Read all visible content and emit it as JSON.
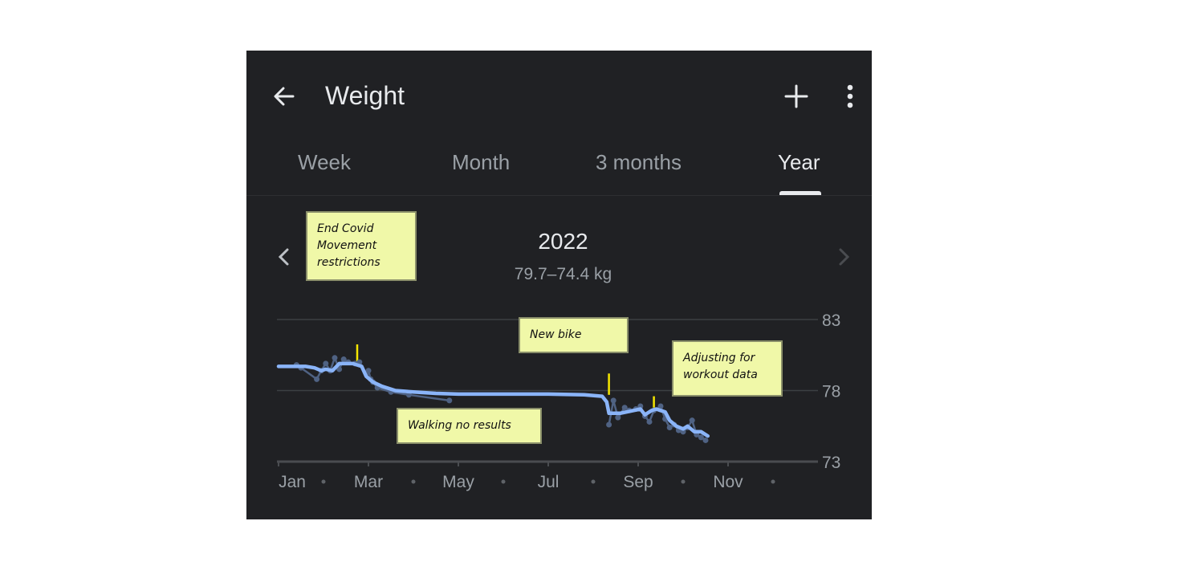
{
  "header": {
    "title": "Weight",
    "back_icon": "arrow-left-icon",
    "add_icon": "plus-icon",
    "more_icon": "more-vert-icon"
  },
  "tabs": [
    {
      "label": "Week",
      "active": false
    },
    {
      "label": "Month",
      "active": false
    },
    {
      "label": "3 months",
      "active": false
    },
    {
      "label": "Year",
      "active": true
    }
  ],
  "period": {
    "year": "2022",
    "range": "79.7–74.4 kg",
    "prev_icon": "chevron-left-icon",
    "next_icon": "chevron-right-icon"
  },
  "colors": {
    "background": "#202124",
    "trend_line": "#8ab4f8",
    "points": "#4f6283",
    "grid": "#3c4043",
    "annotation_bg": "#f0f8a8",
    "annotation_marker": "#f5e600"
  },
  "annotations": [
    {
      "text": [
        "End Covid",
        "Movement",
        "restrictions"
      ],
      "month": 1.75
    },
    {
      "text": [
        "Walking no results"
      ],
      "month": null
    },
    {
      "text": [
        "New bike"
      ],
      "month": 7.35
    },
    {
      "text": [
        "Adjusting for",
        "workout data"
      ],
      "month": 8.35
    }
  ],
  "chart_data": {
    "type": "line",
    "title": "2022",
    "subtitle": "79.7–74.4 kg",
    "xlabel": "",
    "ylabel": "kg",
    "x_ticks": [
      "Jan",
      "Mar",
      "May",
      "Jul",
      "Sep",
      "Nov"
    ],
    "y_ticks": [
      73,
      78,
      83
    ],
    "ylim": [
      73,
      83
    ],
    "xlim_months": [
      0,
      12
    ],
    "grid": true,
    "series": [
      {
        "name": "trend",
        "x_months": [
          0,
          0.3,
          0.6,
          0.8,
          0.95,
          1.05,
          1.2,
          1.35,
          1.5,
          1.65,
          1.75,
          1.85,
          1.95,
          2.1,
          2.3,
          2.6,
          3.0,
          3.5,
          4.0,
          5.0,
          6.0,
          6.8,
          7.2,
          7.3,
          7.35,
          7.4,
          7.6,
          7.9,
          8.05,
          8.15,
          8.3,
          8.4,
          8.5,
          8.6,
          8.7,
          8.85,
          9.0,
          9.1,
          9.25,
          9.4,
          9.55
        ],
        "values": [
          79.7,
          79.7,
          79.7,
          79.6,
          79.4,
          79.5,
          79.4,
          79.9,
          79.9,
          79.9,
          79.8,
          79.7,
          79.0,
          78.6,
          78.3,
          78.0,
          77.9,
          77.8,
          77.75,
          77.75,
          77.75,
          77.7,
          77.6,
          77.2,
          76.4,
          76.4,
          76.4,
          76.6,
          76.7,
          76.3,
          76.6,
          76.7,
          76.6,
          76.5,
          75.9,
          75.5,
          75.3,
          75.5,
          75.1,
          75.1,
          74.8
        ]
      },
      {
        "name": "measurements",
        "x_months": [
          0.4,
          0.5,
          0.85,
          0.95,
          1.05,
          1.15,
          1.25,
          1.35,
          1.45,
          1.55,
          1.7,
          1.8,
          1.95,
          2.0,
          2.05,
          2.1,
          2.2,
          2.5,
          2.9,
          3.8,
          7.35,
          7.45,
          7.55,
          7.7,
          7.8,
          7.95,
          8.05,
          8.15,
          8.25,
          8.35,
          8.5,
          8.6,
          8.7,
          8.8,
          8.9,
          9.0,
          9.1,
          9.2,
          9.3,
          9.4,
          9.5
        ],
        "values": [
          79.8,
          79.6,
          78.8,
          79.4,
          79.9,
          79.4,
          80.3,
          79.5,
          80.2,
          80.0,
          79.9,
          80.0,
          79.2,
          79.4,
          78.8,
          78.6,
          78.2,
          77.9,
          77.7,
          77.3,
          75.6,
          77.3,
          76.1,
          76.8,
          76.6,
          76.7,
          76.9,
          76.2,
          75.8,
          76.6,
          76.9,
          76.0,
          75.4,
          75.6,
          75.2,
          75.1,
          75.4,
          75.9,
          74.9,
          74.7,
          74.5
        ]
      }
    ],
    "annotations": [
      "End Covid Movement restrictions",
      "Walking no results",
      "New bike",
      "Adjusting for workout data"
    ]
  }
}
